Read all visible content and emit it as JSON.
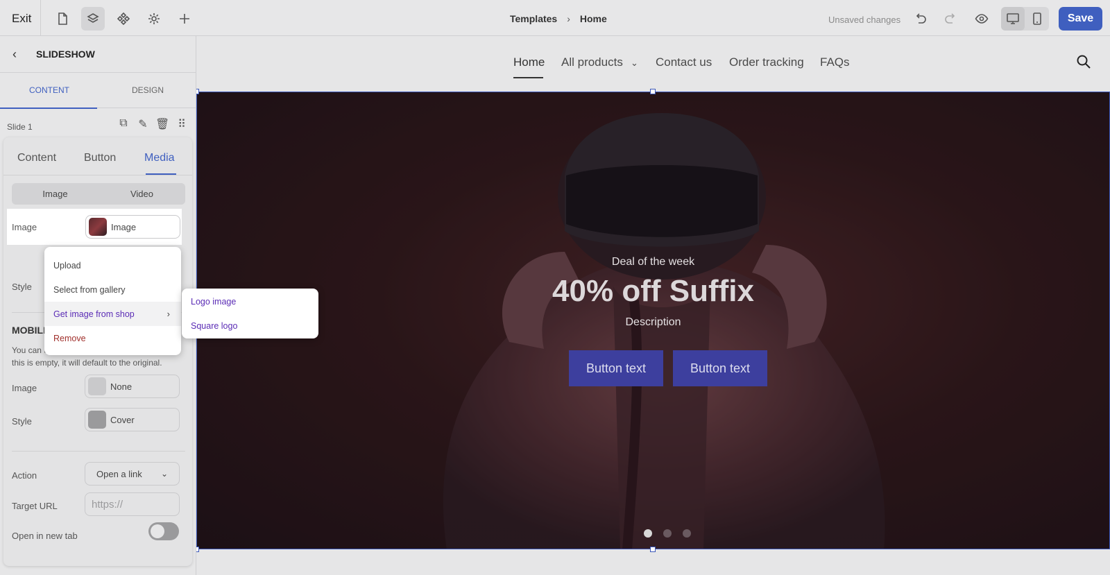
{
  "topbar": {
    "exit_label": "Exit",
    "breadcrumb": [
      "Templates",
      "Home"
    ],
    "unsaved_label": "Unsaved changes",
    "save_label": "Save"
  },
  "sidebar": {
    "title": "SLIDESHOW",
    "tabs": [
      "CONTENT",
      "DESIGN"
    ],
    "slide_label": "Slide 1",
    "card_tabs": [
      "Content",
      "Button",
      "Media"
    ],
    "media_types": [
      "Image",
      "Video"
    ],
    "image_label": "Image",
    "image_value": "Image",
    "style_label": "Style",
    "mobile_title": "MOBILE",
    "mobile_help": "You can upload a unique mobile image. If this is empty, it will default to the original.",
    "mobile_image_label": "Image",
    "mobile_image_value": "None",
    "mobile_style_label": "Style",
    "mobile_style_value": "Cover",
    "action_label": "Action",
    "action_value": "Open a link",
    "target_url_label": "Target URL",
    "target_url_placeholder": "https://",
    "new_tab_label": "Open in new tab"
  },
  "image_menu": {
    "items": [
      "Upload",
      "Select from gallery",
      "Get image from shop",
      "Remove"
    ],
    "submenu": [
      "Logo image",
      "Square logo"
    ]
  },
  "preview": {
    "nav": [
      "Home",
      "All products",
      "Contact us",
      "Order tracking",
      "FAQs"
    ],
    "hero": {
      "kicker": "Deal of the week",
      "title": "40% off Suffix",
      "description": "Description",
      "buttons": [
        "Button text",
        "Button text"
      ],
      "slide_count": 3,
      "active_slide": 1
    }
  },
  "colors": {
    "accent": "#3f5fbf",
    "submenu_text": "#5a2bb5",
    "danger": "#a0302c",
    "hero_button": "#3d3f9e"
  }
}
